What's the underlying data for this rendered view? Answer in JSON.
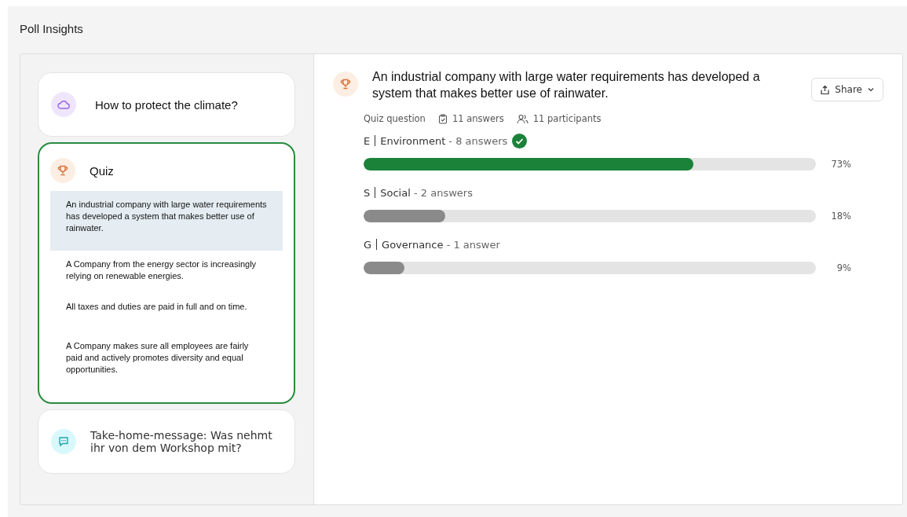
{
  "page_title": "Poll Insights",
  "sidebar": {
    "cards": [
      {
        "kind": "cloud",
        "title": "How to protect the climate?",
        "active": false
      },
      {
        "kind": "trophy",
        "title": "Quiz",
        "active": true,
        "questions": [
          {
            "text": "An industrial company with large water requirements has developed a system that makes better use of rainwater.",
            "selected": true
          },
          {
            "text": "A Company from the energy sector is increasingly relying on renewable energies.",
            "selected": false
          },
          {
            "text": "All taxes and duties are paid in full and on time.",
            "selected": false
          },
          {
            "text": "A Company makes sure all employees are fairly paid and actively promotes diversity and equal opportunities.",
            "selected": false
          }
        ]
      },
      {
        "kind": "chat",
        "title": "Take-home-message: Was nehmt ihr von dem Workshop mit?",
        "active": false
      }
    ]
  },
  "detail": {
    "question": "An industrial company with large water requirements has developed a system that makes better use of rainwater.",
    "share_button": "Share",
    "type": "Quiz question",
    "answers": "11 answers",
    "participants": "11 participants",
    "options": [
      {
        "letter": "E",
        "name": "Environment",
        "count": "- 8 answers",
        "correct": true,
        "level": 0.73,
        "percent": "73%"
      },
      {
        "letter": "S",
        "name": "Social",
        "count": "- 2 answers",
        "correct": false,
        "level": 0.18,
        "percent": "18%"
      },
      {
        "letter": "G",
        "name": "Governance",
        "count": "- 1 answer",
        "correct": false,
        "level": 0.09,
        "percent": "9%"
      }
    ]
  }
}
